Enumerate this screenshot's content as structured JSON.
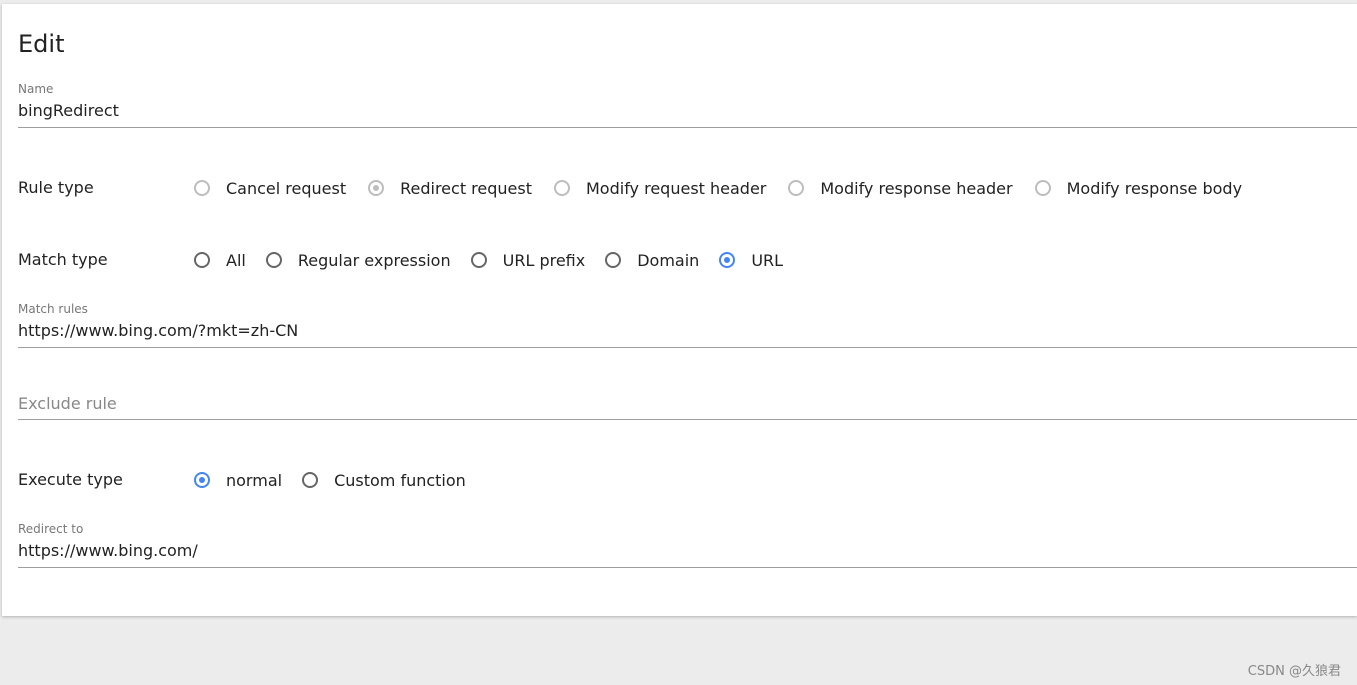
{
  "dialog": {
    "title": "Edit"
  },
  "name": {
    "label": "Name",
    "value": "bingRedirect"
  },
  "rule_type": {
    "label": "Rule type",
    "options": [
      "Cancel request",
      "Redirect request",
      "Modify request header",
      "Modify response header",
      "Modify response body"
    ],
    "selected": "Redirect request"
  },
  "match_type": {
    "label": "Match type",
    "options": [
      "All",
      "Regular expression",
      "URL prefix",
      "Domain",
      "URL"
    ],
    "selected": "URL"
  },
  "match_rules": {
    "label": "Match rules",
    "value": "https://www.bing.com/?mkt=zh-CN"
  },
  "exclude_rule": {
    "placeholder": "Exclude rule"
  },
  "execute_type": {
    "label": "Execute type",
    "options": [
      "normal",
      "Custom function"
    ],
    "selected": "normal"
  },
  "redirect_to": {
    "label": "Redirect to",
    "value": "https://www.bing.com/"
  },
  "watermark": "CSDN @久狼君",
  "colors": {
    "accent": "#4285f4",
    "disabled": "#bdbdbd",
    "background": "#ececec"
  }
}
